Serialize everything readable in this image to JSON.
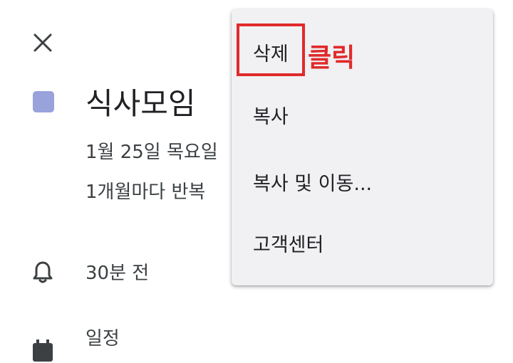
{
  "event": {
    "title": "식사모임",
    "date": "1월 25일 목요일",
    "repeat": "1개월마다 반복",
    "color": "#9aa2dc"
  },
  "reminder": {
    "text": "30분 전",
    "icon": "bell-icon"
  },
  "calendar": {
    "text": "일정",
    "icon": "calendar-icon"
  },
  "close": {
    "icon": "close-icon"
  },
  "menu": {
    "items": [
      {
        "label": "삭제"
      },
      {
        "label": "복사"
      },
      {
        "label": "복사 및 이동..."
      },
      {
        "label": "고객센터"
      }
    ]
  },
  "annotation": {
    "label": "클릭",
    "color": "#e02a2a"
  }
}
